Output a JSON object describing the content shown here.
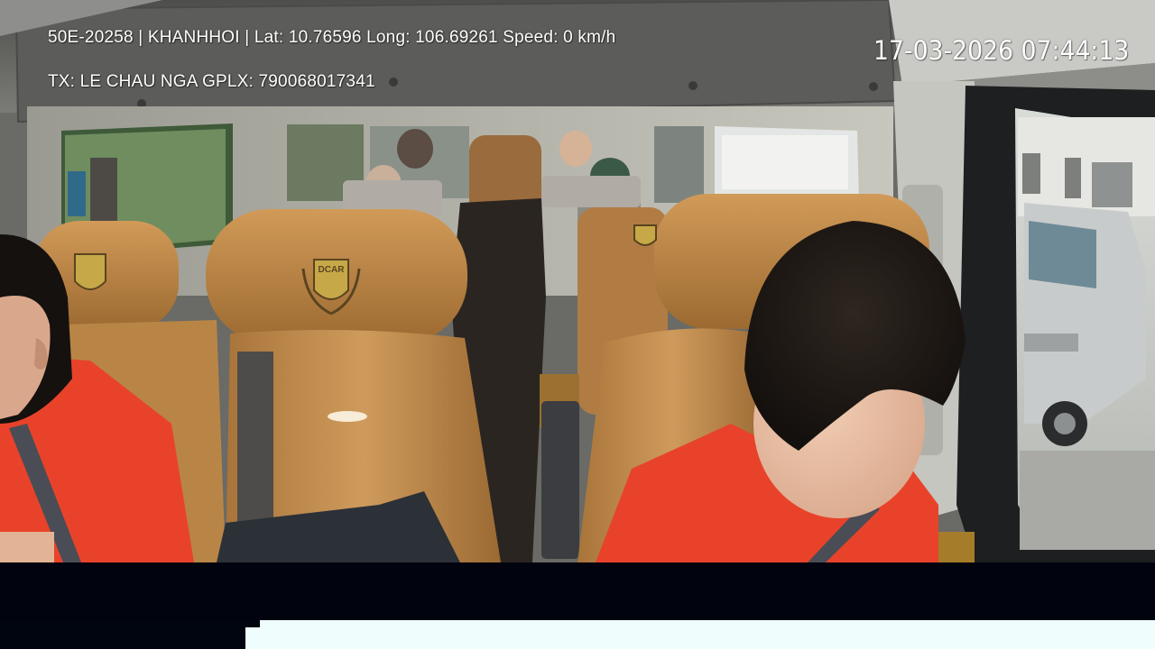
{
  "overlay": {
    "vehicle_info": "50E-20258 | KHANHHOI | Lat: 10.76596 Long: 106.69261 Speed: 0 km/h",
    "driver_info": "TX: LE CHAU NGA GPLX: 790068017341",
    "datetime": "17-03-2026 07:44:13"
  },
  "scene": {
    "headrest_logo": "DCAR",
    "colors": {
      "seat_leather": "#b98546",
      "shirt": "#e8432a",
      "ceiling": "#6b6b68",
      "window_glass": "#aeb6b2"
    }
  }
}
